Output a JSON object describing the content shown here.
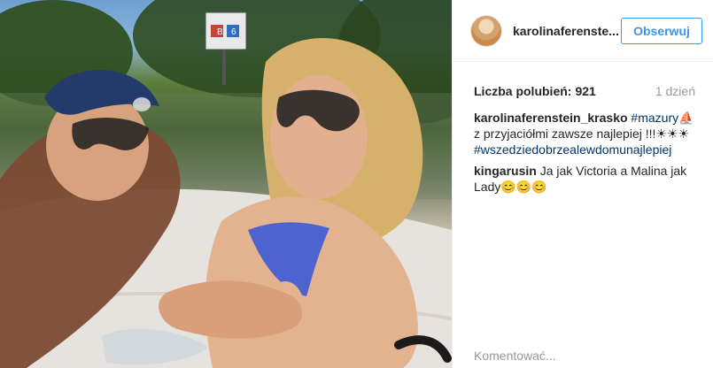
{
  "post": {
    "username": "karolinaferenstein_krasko",
    "username_short": "karolinaferenste...",
    "follow_label": "Obserwuj",
    "likes_label": "Liczba polubień:",
    "likes_count": "921",
    "time_ago": "1 dzień",
    "caption": {
      "user": "karolinaferenstein_krasko",
      "hashtag_1": "#mazury",
      "sail_emoji": "⛵",
      "text": "z przyjaciółmi zawsze najlepiej !!!",
      "sun_emojis": "☀☀☀",
      "hashtag_2": "#wszedziedobrzealewdomunajlepiej"
    },
    "comments": [
      {
        "user": "kingarusin",
        "text": "Ja jak Victoria a Malina jak Lady",
        "emojis": "😊😊😊"
      }
    ],
    "comment_placeholder": "Komentować..."
  },
  "photo": {
    "sign_top": "...",
    "sign_b": "B",
    "sign_6": "6"
  }
}
